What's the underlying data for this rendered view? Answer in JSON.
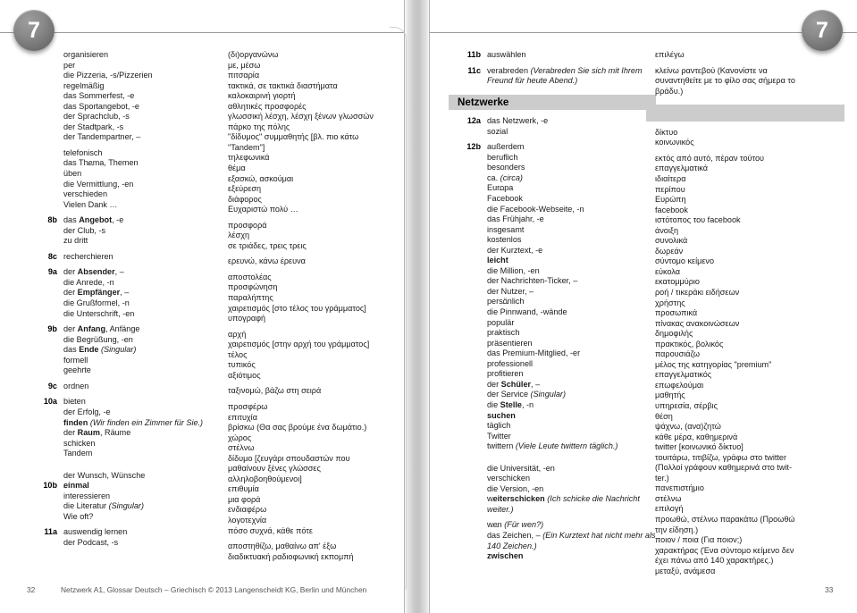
{
  "document": {
    "chapter_badge": "7",
    "footer_text": "Netzwerk A1, Glossar Deutsch – Griechisch © 2013 Langenscheidt KG, Berlin und München",
    "page_left": "32",
    "page_right": "33"
  },
  "section_heading": "Netzwerke",
  "col_de_left": [
    {
      "label": "",
      "lines": [
        "organis<u>ie</u>ren",
        "p<u>e</u>r",
        "die Pizzer<u>i</u>a, -s/Pizzer<u>ie</u>n",
        "r<u>e</u>gelmäßig",
        "das S<u>o</u>mmerfest, -e",
        "das Sp<u>o</u>rtangebot, -e",
        "der Spr<u>a</u>chclub, -s",
        "der St<u>a</u>dtpark, -s",
        "der T<u>a</u>ndempartner, –"
      ]
    },
    {
      "label": "",
      "gap_before": true,
      "lines": [
        "telef<u>o</u>nisch",
        "das Th<u>e</u>ma, Themen",
        "<u>ü</u>ben",
        "die Verm<u>i</u>ttlung, -en",
        "versch<u>ie</u>den",
        "Vielen D<u>a</u>nk …"
      ]
    },
    {
      "label": "8b",
      "gap_before": true,
      "lines": [
        "das <b>A</b><u><b>n</b></u><b>gebot</b>, -e",
        "der Cl<u>u</u>b, -s",
        "zu dr<u>i</u>tt"
      ]
    },
    {
      "label": "8c",
      "gap_before": true,
      "lines": [
        "recherch<u>ie</u>ren"
      ]
    },
    {
      "label": "9a",
      "gap_before": true,
      "lines": [
        "der <b>A</b><u><b>b</b></u><b>sender</b>, –",
        "die <u>A</u>nrede, -n",
        "der <b>Empfä</b><u><b>n</b></u><b>ger</b>, –",
        "die Gr<u>u</u>ßformel, -n",
        "die <u>U</u>nterschrift, -en"
      ]
    },
    {
      "label": "9b",
      "gap_before": true,
      "lines": [
        "der <b>A</b><u><b>n</b></u><b>fang</b>, Anfänge",
        "die Begr<u>ü</u>ßung, -en",
        "das <b>E</b><u><b>n</b></u><b>de</b> <i>(Singular)</i>",
        "form<u>e</u>ll",
        "ge<u>e</u>hrte"
      ]
    },
    {
      "label": "9c",
      "gap_before": true,
      "lines": [
        "<u>o</u>rdnen"
      ]
    },
    {
      "label": "10a",
      "gap_before": true,
      "lines": [
        "b<u>ie</u>ten",
        "der Erf<u>o</u>lg, -e",
        "<b>fi</b><u><b>n</b></u><b>den</b> <i>(Wir finden ein Zimmer für Sie.)</i>",
        "der <b>Raum</b>, R<u>ä</u>ume",
        "sch<u>i</u>cken",
        "T<u>a</u>ndem"
      ]
    },
    {
      "label": "",
      "gap_before": true,
      "big_gap": true,
      "lines": [
        "der W<u>u</u>nsch, W<u>ü</u>nsche"
      ]
    },
    {
      "label": "10b",
      "lines": [
        "<u><b>ei</b></u><b>nmal</b>",
        "interess<u>ie</u>ren",
        "die Literat<u>u</u>r <i>(Singular)</i>",
        "W<u>ie</u> oft?"
      ]
    },
    {
      "label": "11a",
      "gap_before": true,
      "lines": [
        "<u>au</u>swendig lernen",
        "der P<u>o</u>dcast, -s"
      ]
    }
  ],
  "col_el_left": [
    {
      "lines": [
        "(δι)οργανώνω",
        "με, μέσω",
        "πιτσαρία",
        "τακτικά, σε τακτικά διαστήματα",
        "καλοκαιρινή γιορτή",
        "αθλητικές προσφορές",
        "γλωσσική λέσχη, λέσχη ξένων γλωσσών",
        "πάρκο της πόλης",
        "\"δίδυμος\" συμμαθητής [βλ. πιο κάτω",
        "\"Tandem\"]"
      ]
    },
    {
      "lines": [
        "τηλεφωνικά",
        "θέμα",
        "εξασκώ, ασκούμαι",
        "εξεύρεση",
        "διάφορος",
        "Ευχαριστώ πολύ …"
      ]
    },
    {
      "gap_before": true,
      "lines": [
        "προσφορά",
        "λέσχη",
        "σε τριάδες, τρεις τρεις"
      ]
    },
    {
      "gap_before": true,
      "lines": [
        "ερευνώ, κάνω έρευνα"
      ]
    },
    {
      "gap_before": true,
      "lines": [
        "αποστολέας",
        "προσφώνηση",
        "παραλήπτης",
        "χαιρετισμός [στο τέλος του γράμματος]",
        "υπογραφή"
      ]
    },
    {
      "gap_before": true,
      "lines": [
        "αρχή",
        "χαιρετισμός [στην αρχή του γράμματος]",
        "τέλος",
        "τυπικός",
        "αξιότιμος"
      ]
    },
    {
      "gap_before": true,
      "lines": [
        "ταξινομώ, βάζω στη σειρά"
      ]
    },
    {
      "gap_before": true,
      "lines": [
        "προσφέρω",
        "επιτυχία",
        "βρίσκω (Θα σας βρούμε ένα δωμάτιο.)",
        "χώρος",
        "στέλνω",
        "δίδυμο [ζευγάρι σπουδαστών που",
        "μαθαίνουν ξένες γλώσσες",
        "αλληλοβοηθούμενοι]"
      ]
    },
    {
      "lines": [
        "επιθυμία",
        "μια φορά",
        "ενδιαφέρω",
        "λογοτεχνία",
        "πόσο συχνά, κάθε πότε"
      ]
    },
    {
      "gap_before": true,
      "lines": [
        "αποστηθίζω, μαθαίνω απ' έξω",
        "διαδικτυακή ραδιοφωνική εκπομπή"
      ]
    }
  ],
  "col_de_right": [
    {
      "label": "11b",
      "lines": [
        "<u>au</u>swählen"
      ]
    },
    {
      "label": "11c",
      "gap_before": true,
      "lines": [
        "ver<u>a</u>breden <i>(Verabreden Sie sich mit Ihrem</i>",
        "<i>Freund für heute Abend.)</i>"
      ]
    },
    {
      "label": "12a",
      "section": true,
      "lines": [
        "das N<u>e</u>tzwerk, -e",
        "sozi<u>a</u>l"
      ]
    },
    {
      "label": "12b",
      "gap_before": true,
      "lines": [
        "<u>au</u>ßerdem",
        "ber<u>u</u>flich",
        "bes<u>o</u>nders",
        "ca. <i>(circa)</i>",
        "Eur<u>o</u>pa",
        "Facebook",
        "die Facebook-Webseite, -n",
        "das Fr<u>ü</u>hjahr, -e",
        "insges<u>a</u>mt",
        "k<u>o</u>stenlos",
        "der K<u>u</u>rztext, -e",
        "<b>l</b><u><b>ei</b></u><b>cht</b>",
        "die Milli<u>o</u>n, -en",
        "der N<u>a</u>chrichten-Ticker, –",
        "der N<u>u</u>tzer, –",
        "pers<u>ö</u>nlich",
        "die P<u>i</u>nnwand, -wände",
        "popul<u>ä</u>r",
        "pr<u>a</u>ktisch",
        "präsent<u>ie</u>ren",
        "das Pr<u>e</u>mium-Mitglied, -er",
        "profession<u>e</u>ll",
        "profit<u>ie</u>ren",
        "der <b>Schü</b><u><b>l</b></u><b>er</b>, –",
        "der S<u>e</u>rvice <i>(Singular)</i>",
        "die <b>St</b><u><b>e</b></u><b>lle</b>, -n",
        "<b>s</b><u><b>u</b></u><b>chen</b>",
        "t<u>ä</u>glich",
        "Twitter",
        "tw<u>i</u>ttern <i>(Viele Leute twittern täglich.)</i>"
      ]
    },
    {
      "label": "",
      "gap_before": true,
      "big_gap": true,
      "lines": [
        "die Universit<u>ä</u>t, -en",
        "versch<u>i</u>cken",
        "die Versi<u>o</u>n, -en",
        "w<u><b>ei</b></u><b>terschicken</b> <i>(Ich schicke die Nachricht</i>",
        "<i>weiter.)</i>"
      ]
    },
    {
      "label": "",
      "gap_before": true,
      "lines": [
        "w<u>e</u>n <i>(Für wen?)</i>",
        "das Z<u>ei</u>chen, – <i>(Ein Kurztext hat nicht mehr als</i>",
        "<i>140 Zeichen.)</i>",
        "<b>zw</b><u><b>i</b></u><b>schen</b>"
      ]
    }
  ],
  "col_el_right": [
    {
      "lines": [
        "επιλέγω"
      ]
    },
    {
      "gap_before": true,
      "lines": [
        "κλείνω ραντεβού (Κανονίστε να",
        "συναντηθείτε με το φίλο σας σήμερα το",
        "βράδυ.)"
      ]
    },
    {
      "section": true,
      "lines": [
        "δίκτυο",
        "κοινωνικός"
      ]
    },
    {
      "gap_before": true,
      "lines": [
        "εκτός από αυτό, πέραν τούτου",
        "επαγγελματικά",
        "ιδιαίτερα",
        "περίπου",
        "Ευρώπη",
        "facebook",
        "ιστότοπος του facebook",
        "άνοιξη",
        "συνολικά",
        "δωρεάν",
        "σύντομο κείμενο",
        "εύκολα",
        "εκατομμύριο",
        "ροή / τικεράκι ειδήσεων",
        "χρήστης",
        "προσωπικά",
        "πίνακας ανακοινώσεων",
        "δημοφιλής",
        "πρακτικός, βολικός",
        "παρουσιάζω",
        "μέλος της κατηγορίας \"premium\"",
        "επαγγελματικός",
        "επωφελούμαι",
        "μαθητής",
        "υπηρεσία, σέρβις",
        "θέση",
        "ψάχνω, (ανα)ζητώ",
        "κάθε μέρα, καθημερινά",
        "twitter [κοινωνικό δίκτυο]",
        "τουιτάρω, τιτιβίζω, γράφω στο twitter",
        "(Πολλοί γράφουν καθημερινά στο twit-",
        "ter.)"
      ]
    },
    {
      "lines": [
        "πανεπιστήμιο",
        "στέλνω",
        "επιλογή",
        "προωθώ, στέλνω παρακάτω (Προωθώ",
        "την είδηση.)"
      ]
    },
    {
      "lines": [
        "ποιον / ποια (Για ποιον;)",
        "χαρακτήρας (Ένα σύντομο κείμενο δεν",
        "έχει πάνω από 140 χαρακτήρες.)",
        "μεταξύ, ανάμεσα"
      ]
    }
  ]
}
